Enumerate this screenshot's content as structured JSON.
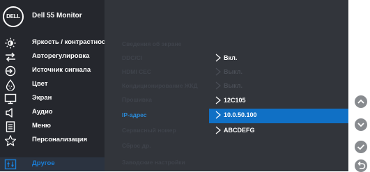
{
  "brand": {
    "logo_text": "DELL",
    "model": "Dell 55 Monitor"
  },
  "menu": [
    {
      "label": "Яркость / контрастность",
      "icon": "brightness-icon"
    },
    {
      "label": "Авторегулировка",
      "icon": "auto-adjust-icon"
    },
    {
      "label": "Источник сигнала",
      "icon": "input-source-icon"
    },
    {
      "label": "Цвет",
      "icon": "color-icon"
    },
    {
      "label": "Экран",
      "icon": "display-icon"
    },
    {
      "label": "Аудио",
      "icon": "audio-icon"
    },
    {
      "label": "Меню",
      "icon": "menu-icon"
    },
    {
      "label": "Персонализация",
      "icon": "personalize-icon"
    },
    {
      "label": "Другое",
      "icon": "others-icon",
      "active": true
    }
  ],
  "submenu": [
    "Сведения об экране",
    "DDC/CI",
    "HDMI CEC",
    "Кондиционирование ЖКД",
    "Прошивка",
    "IP-адрес",
    "Сервисный номер",
    "Сброс др.",
    "Заводские настройки"
  ],
  "submenu_active_index": 5,
  "values": {
    "ddcci": "Вкл.",
    "hdmi_cec": "Выкл.",
    "lcd_conditioning": "Выкл.",
    "firmware": "12C105",
    "ip_address": "10.0.50.100",
    "service_tag": "ABCDEFG"
  },
  "side_buttons": [
    "up-arrow-icon",
    "down-arrow-icon",
    "check-icon",
    "back-icon"
  ],
  "colors": {
    "accent": "#1070c5",
    "active_text": "#1a7fd8"
  }
}
